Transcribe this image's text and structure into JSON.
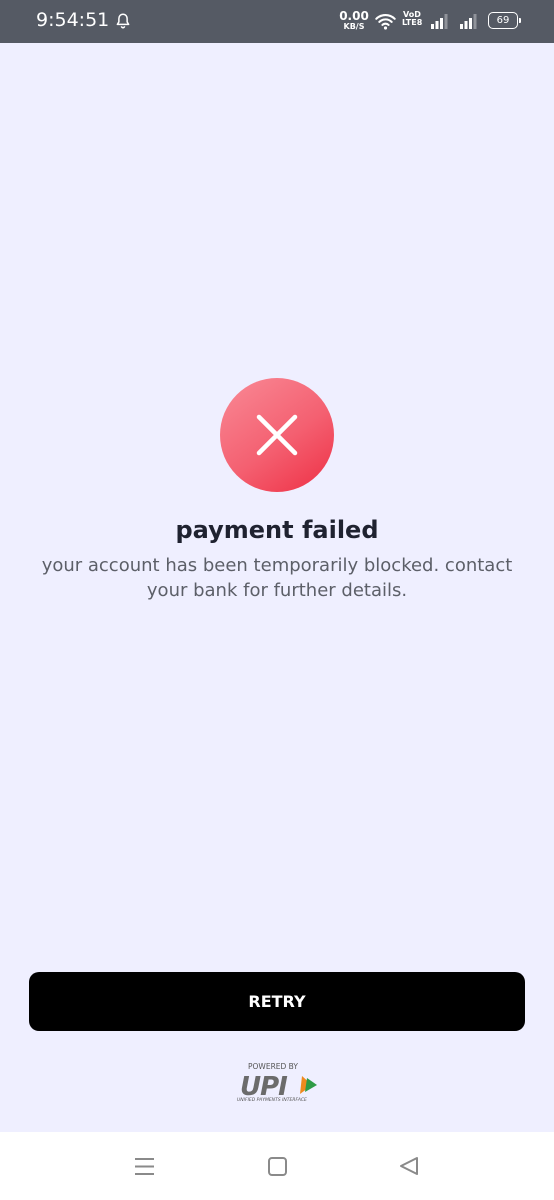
{
  "status_bar": {
    "time": "9:54:51",
    "net_speed_value": "0.00",
    "net_speed_unit": "KB/S",
    "volte_top": "VoD",
    "volte_bottom": "LTE8",
    "battery_level": "69",
    "icons": [
      "bell-icon",
      "wifi-icon",
      "signal-icon",
      "signal-icon",
      "battery-icon"
    ]
  },
  "result": {
    "icon": "close-icon",
    "icon_color": "#f25568",
    "title": "payment failed",
    "message": "your account has been temporarily blocked. contact your bank for further details."
  },
  "actions": {
    "retry_label": "RETRY"
  },
  "footer": {
    "powered_by": "POWERED BY",
    "brand": "UPI",
    "brand_subtitle": "UNIFIED PAYMENTS INTERFACE"
  },
  "nav_bar": {
    "icons": [
      "menu-icon",
      "home-icon",
      "back-icon"
    ]
  }
}
